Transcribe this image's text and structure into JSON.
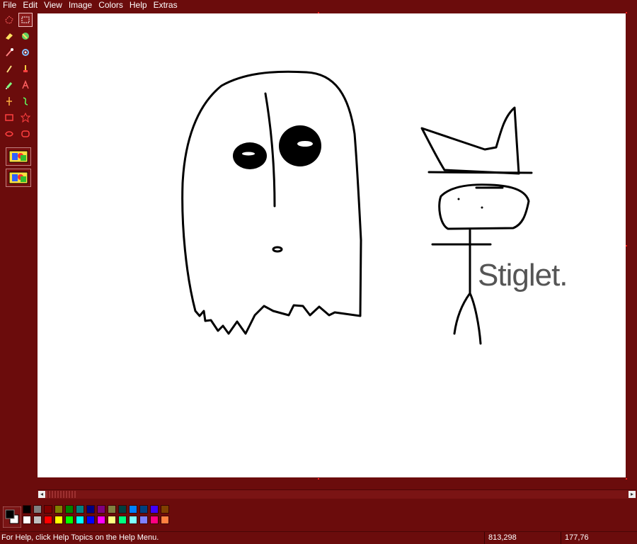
{
  "menu": [
    "File",
    "Edit",
    "View",
    "Image",
    "Colors",
    "Help",
    "Extras"
  ],
  "tools": [
    {
      "name": "free-select-icon",
      "color": "#ff6060"
    },
    {
      "name": "rect-select-icon",
      "color": "#ffffff"
    },
    {
      "name": "eraser-icon",
      "color": "#ffe060"
    },
    {
      "name": "fill-bucket-icon",
      "color": "#60d060"
    },
    {
      "name": "color-picker-icon",
      "color": "#ff8080"
    },
    {
      "name": "magnifier-icon",
      "color": "#80c0ff"
    },
    {
      "name": "pencil-icon",
      "color": "#ffe080"
    },
    {
      "name": "brush-icon",
      "color": "#ffd040"
    },
    {
      "name": "airbrush-icon",
      "color": "#80ff80"
    },
    {
      "name": "text-icon",
      "color": "#ff6060"
    },
    {
      "name": "line-icon",
      "color": "#ffb040"
    },
    {
      "name": "curve-icon",
      "color": "#60ff60"
    },
    {
      "name": "rectangle-icon",
      "color": "#ff4040"
    },
    {
      "name": "polygon-icon",
      "color": "#ff4040"
    },
    {
      "name": "ellipse-icon",
      "color": "#ff4040"
    },
    {
      "name": "rounded-rect-icon",
      "color": "#ff4040"
    }
  ],
  "drawing": {
    "label": "Stiglet."
  },
  "palette": {
    "primary": "#000000",
    "secondary": "#ffffff",
    "row1": [
      "#000000",
      "#808080",
      "#800000",
      "#808000",
      "#008000",
      "#008080",
      "#000080",
      "#800080",
      "#808040",
      "#004040",
      "#0080ff",
      "#004080",
      "#4000ff",
      "#804000"
    ],
    "row2": [
      "#ffffff",
      "#c0c0c0",
      "#ff0000",
      "#ffff00",
      "#00ff00",
      "#00ffff",
      "#0000ff",
      "#ff00ff",
      "#ffff80",
      "#00ff80",
      "#80ffff",
      "#8080ff",
      "#ff0080",
      "#ff8040"
    ]
  },
  "status": {
    "help": "For Help, click Help Topics on the Help Menu.",
    "position": "813,298",
    "size": "177,76"
  }
}
